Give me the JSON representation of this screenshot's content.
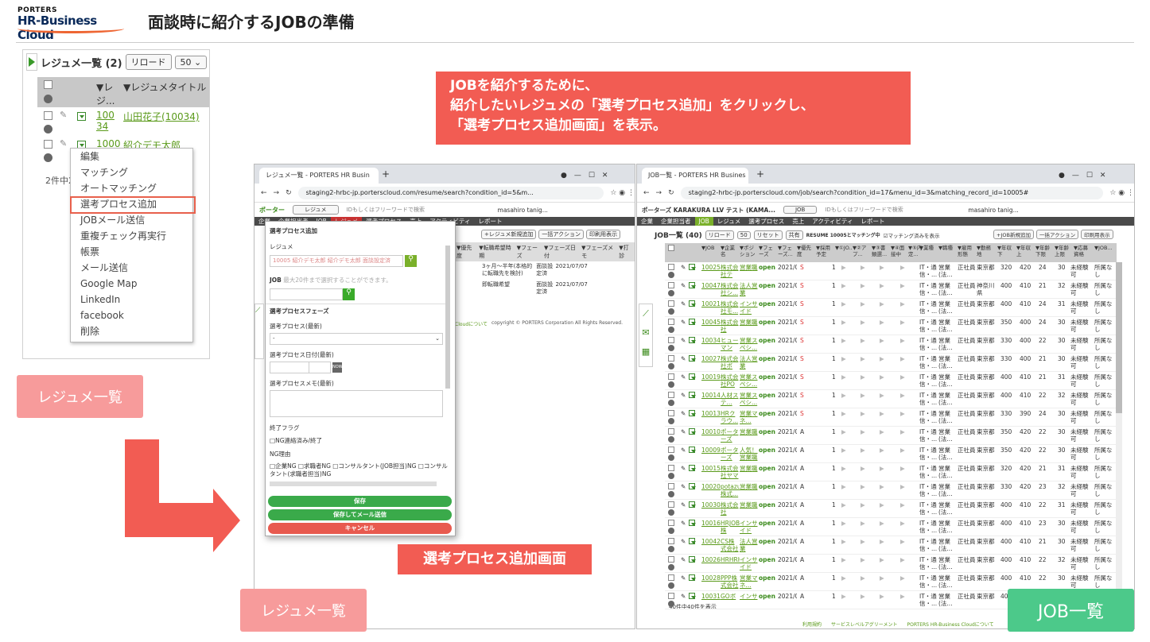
{
  "header": {
    "logo_top": "PORTERS",
    "logo_main": "HR-Business Cloud",
    "title": "面談時に紹介するJOBの準備"
  },
  "resume_panel": {
    "title": "レジュメ一覧 (2)",
    "reload": "リロード",
    "per_page": "50",
    "col_id": "▼レジ...",
    "col_title": "▼レジュメタイトル",
    "rows": [
      {
        "id": "10034",
        "name": "山田花子(10034)"
      },
      {
        "id": "1000",
        "name": "紹介デモ太郎"
      }
    ],
    "count": "2件中2件"
  },
  "context_menu": [
    "編集",
    "マッチング",
    "オートマッチング",
    "選考プロセス追加",
    "JOBメール送信",
    "重複チェック再実行",
    "帳票",
    "メール送信",
    "Google Map",
    "LinkedIn",
    "facebook",
    "削除"
  ],
  "label_resume_list": "レジュメ一覧",
  "callout": [
    "JOBを紹介するために、",
    "紹介したいレジュメの「選考プロセス追加」をクリックし、",
    "「選考プロセス追加画面」を表示。"
  ],
  "left_browser": {
    "tab": "レジュメ一覧 - PORTERS HR Busin",
    "url": "staging2-hrbc-jp.porterscloud.com/resume/search?condition_id=5&m...",
    "app": "ポーター",
    "search_sel": "レジュメ",
    "search_ph": "IDもしくはフリーワードで検索",
    "user": "masahiro tanig...",
    "nav": [
      "企業",
      "企業担当者",
      "JOB",
      "レジュメ",
      "選考プロセス",
      "売上",
      "アクティビティ",
      "レポート"
    ],
    "buttons": [
      "+レジュメ新規追加",
      "一括アクション",
      "印刷用表示"
    ],
    "cols": [
      "▼優先度",
      "▼転職希望時期",
      "▼フェーズ",
      "▼フェーズ日付",
      "▼フェーズメモ",
      "▼打診"
    ],
    "rows": [
      [
        "3ヶ月〜半年(本格的に転職先を検討)",
        "面談設定済",
        "2021/07/07"
      ],
      [
        "即転職希望",
        "面談設定済",
        "2021/07/07"
      ]
    ],
    "footer": "copyright © PORTERS Corporation All Rights Reserved.",
    "footer_link": "Cloudについて"
  },
  "modal": {
    "title": "選考プロセス追加",
    "resume_label": "レジュメ",
    "resume_value": "10005 紹介デモ太郎 紹介デモ太郎 面談設定済",
    "job_label": "JOB",
    "job_hint": "最大20件まで選択することができます。",
    "phase_header": "選考プロセスフェーズ",
    "phase_label": "選考プロセス(最新)",
    "phase_value": "-",
    "date_label": "選考プロセス日付(最新)",
    "now": "NOW",
    "memo_label": "選考プロセスメモ(最新)",
    "end_flag": "終了フラグ",
    "ng_done": "NG連絡済み/終了",
    "ng_reason": "NG理由",
    "ng_opts": "□企業NG □求職者NG □コンサルタント(JOB担当)NG □コンサルタント(求職者担当)NG",
    "save": "保存",
    "save_mail": "保存してメール送信",
    "cancel": "キャンセル"
  },
  "label_modal": "選考プロセス追加画面",
  "right_browser": {
    "tab": "JOB一覧 - PORTERS HR Busines",
    "url": "staging2-hrbc-jp.porterscloud.com/job/search?condition_id=17&menu_id=3&matching_record_id=10005#",
    "app": "ポーターズ KARAKURA LLV テスト (KAMA...",
    "search_sel": "JOB",
    "search_ph": "IDもしくはフリーワードで検索",
    "user": "masahiro tanig...",
    "nav": [
      "企業",
      "企業担当者",
      "JOB",
      "レジュメ",
      "選考プロセス",
      "売上",
      "アクティビティ",
      "レポート"
    ],
    "list_title": "JOB一覧 (40)",
    "reload": "リロード",
    "per": "50",
    "reset": "リセット",
    "share": "共有",
    "matching": "RESUME 10005とマッチング中",
    "matched": "マッチング済みを表示",
    "buttons": [
      "+JOB新規追加",
      "一括アクション",
      "印刷用表示"
    ],
    "cols": [
      "▼JOB",
      "▼企業名",
      "▼ポジション",
      "▼フェーズ",
      "▼フェーズ...",
      "▼優先度",
      "▼採用予定",
      "▼①JO...",
      "▼②アプ...",
      "▼③書類選...",
      "▼④面接中",
      "▼⑤内定...",
      "▼業種",
      "▼職種",
      "▼雇用形態",
      "▼勤務地",
      "▼年収下",
      "▼年収上",
      "▼年齢下限",
      "▼年齢上限",
      "▼応募資格",
      "▼JOB..."
    ],
    "rows": [
      [
        "10025",
        "株式会社テ",
        "営業職",
        "open",
        "S",
        "東京都",
        "320",
        "420",
        "24",
        "30"
      ],
      [
        "10047",
        "株式会社シ...",
        "法人営業",
        "open",
        "S",
        "神奈川県",
        "400",
        "410",
        "21",
        "32"
      ],
      [
        "10021",
        "株式会社モ...",
        "インサイド",
        "open",
        "S",
        "東京都",
        "400",
        "410",
        "24",
        "31"
      ],
      [
        "10045",
        "株式会社",
        "営業職",
        "open",
        "S",
        "東京都",
        "350",
        "400",
        "24",
        "30"
      ],
      [
        "10034",
        "ヒューマン",
        "営業スペシ...",
        "open",
        "S",
        "東京都",
        "330",
        "400",
        "22",
        "30"
      ],
      [
        "10027",
        "株式会社ボ",
        "法人営業",
        "open",
        "S",
        "東京都",
        "330",
        "400",
        "21",
        "30"
      ],
      [
        "10019",
        "株式会社PO",
        "営業スペシ...",
        "open",
        "S",
        "東京都",
        "400",
        "410",
        "21",
        "31"
      ],
      [
        "10014",
        "人材ステ...",
        "営業スペシ...",
        "open",
        "S",
        "東京都",
        "400",
        "410",
        "22",
        "32"
      ],
      [
        "10013",
        "HRクラウ...",
        "営業マネ...",
        "open",
        "S",
        "東京都",
        "330",
        "390",
        "24",
        "30"
      ],
      [
        "10010",
        "ポーターズ",
        "営業職",
        "open",
        "A",
        "東京都",
        "350",
        "420",
        "22",
        "30"
      ],
      [
        "10009",
        "ポーターズ",
        "人気！営業職",
        "open",
        "A",
        "東京都",
        "350",
        "420",
        "22",
        "30"
      ],
      [
        "10015",
        "株式会社ヤマ",
        "営業職",
        "open",
        "A",
        "東京都",
        "320",
        "420",
        "21",
        "31"
      ],
      [
        "10020",
        "potazu株式...",
        "営業職",
        "open",
        "A",
        "東京都",
        "330",
        "420",
        "23",
        "32"
      ],
      [
        "10030",
        "株式会社",
        "営業職",
        "open",
        "A",
        "東京都",
        "400",
        "410",
        "22",
        "31"
      ],
      [
        "10016",
        "HRJOB株",
        "インサイド",
        "open",
        "A",
        "東京都",
        "400",
        "410",
        "23",
        "30"
      ],
      [
        "10042",
        "CS株式会社",
        "法人営業",
        "open",
        "A",
        "東京都",
        "400",
        "410",
        "21",
        "30"
      ],
      [
        "10026",
        "HRHRHR",
        "インサイド",
        "open",
        "A",
        "東京都",
        "400",
        "410",
        "22",
        "32"
      ],
      [
        "10028",
        "PPP株式会社",
        "営業マネ...",
        "open",
        "A",
        "東京都",
        "400",
        "410",
        "22",
        "30"
      ],
      [
        "10031",
        "GOボ",
        "インサ",
        "open",
        "A",
        "東京都",
        "400",
        "410",
        "22",
        "30"
      ]
    ],
    "row_common": {
      "date": "2021/07/0...",
      "count": "1",
      "industry": "IT・通信・...",
      "job": "営業(法...",
      "type": "正社員",
      "qual": "未経験可",
      "note": "所属なし m..."
    },
    "count": "40件中40件を表示",
    "footer": [
      "利用規約",
      "サービスレベルアグリーメント",
      "PORTERS HR-Business Cloudについて"
    ]
  },
  "label_job_list": "JOB一覧"
}
